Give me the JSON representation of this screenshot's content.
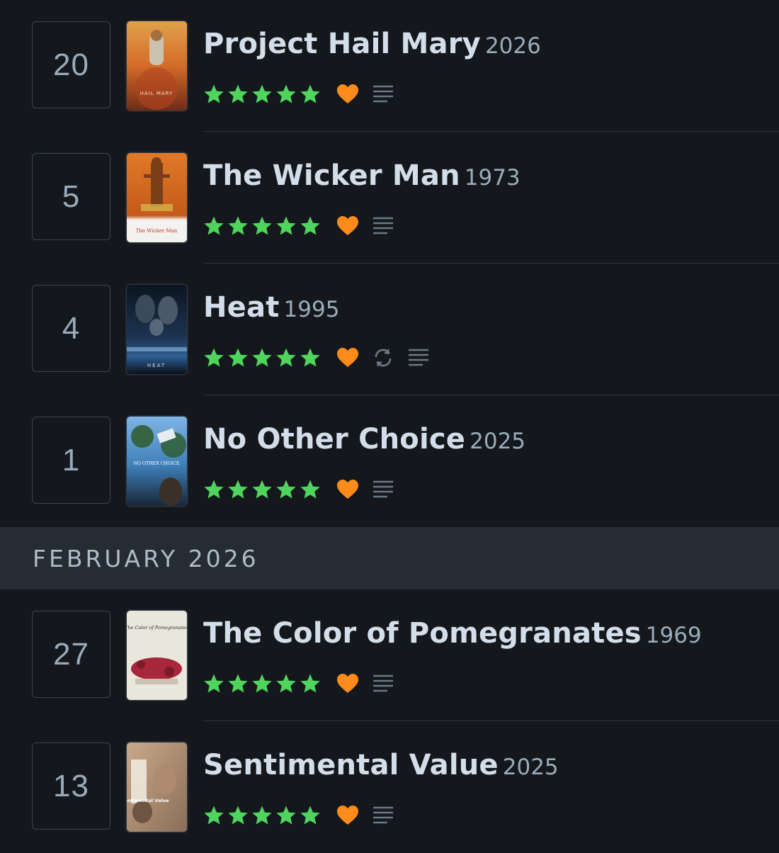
{
  "entries_top": [
    {
      "day": "20",
      "title": "Project Hail Mary",
      "year": "2026",
      "rating": 5,
      "liked": true,
      "rewatch": false,
      "review": true,
      "poster_text": "HAIL MARY"
    },
    {
      "day": "5",
      "title": "The Wicker Man",
      "year": "1973",
      "rating": 5,
      "liked": true,
      "rewatch": false,
      "review": true,
      "poster_text": "The Wicker Man"
    },
    {
      "day": "4",
      "title": "Heat",
      "year": "1995",
      "rating": 5,
      "liked": true,
      "rewatch": true,
      "review": true,
      "poster_text": "HEAT"
    },
    {
      "day": "1",
      "title": "No Other Choice",
      "year": "2025",
      "rating": 5,
      "liked": true,
      "rewatch": false,
      "review": true,
      "poster_text": "NO OTHER CHOICE"
    }
  ],
  "month_header": {
    "label": "FEBRUARY 2026"
  },
  "entries_bottom": [
    {
      "day": "27",
      "title": "The Color of Pomegranates",
      "year": "1969",
      "rating": 5,
      "liked": true,
      "rewatch": false,
      "review": true,
      "poster_text": "The Color of Pomegranates"
    },
    {
      "day": "13",
      "title": "Sentimental Value",
      "year": "2025",
      "rating": 5,
      "liked": true,
      "rewatch": false,
      "review": true,
      "poster_text": "Sentimental Value"
    }
  ],
  "colors": {
    "star": "#40bcf4",
    "star_green": "#4fd45d",
    "heart": "#ff8c1a",
    "icon_muted": "#6b7886",
    "background": "#14181c",
    "month_band": "#252c34"
  },
  "icons": {
    "star": "star-icon",
    "heart": "heart-icon",
    "rewatch": "rewatch-icon",
    "review": "review-lines-icon"
  }
}
